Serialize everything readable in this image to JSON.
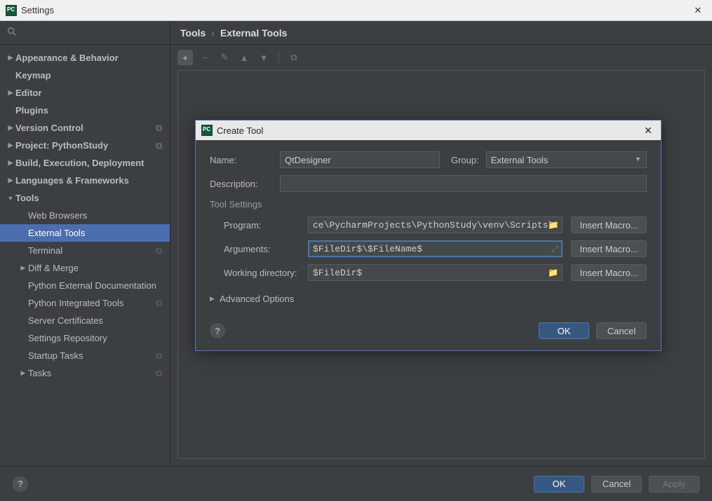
{
  "window": {
    "title": "Settings"
  },
  "search": {
    "placeholder": ""
  },
  "breadcrumb": {
    "root": "Tools",
    "leaf": "External Tools"
  },
  "sidebar": {
    "items": [
      {
        "label": "Appearance & Behavior",
        "bold": true,
        "arrow": "right"
      },
      {
        "label": "Keymap",
        "bold": true,
        "arrow": "none"
      },
      {
        "label": "Editor",
        "bold": true,
        "arrow": "right"
      },
      {
        "label": "Plugins",
        "bold": true,
        "arrow": "none"
      },
      {
        "label": "Version Control",
        "bold": true,
        "arrow": "right",
        "copy": true
      },
      {
        "label": "Project: PythonStudy",
        "bold": true,
        "arrow": "right",
        "copy": true
      },
      {
        "label": "Build, Execution, Deployment",
        "bold": true,
        "arrow": "right"
      },
      {
        "label": "Languages & Frameworks",
        "bold": true,
        "arrow": "right"
      },
      {
        "label": "Tools",
        "bold": true,
        "arrow": "down"
      },
      {
        "label": "Web Browsers",
        "indent": 1,
        "arrow": "none"
      },
      {
        "label": "External Tools",
        "indent": 1,
        "arrow": "none",
        "selected": true
      },
      {
        "label": "Terminal",
        "indent": 1,
        "arrow": "none",
        "copy": true
      },
      {
        "label": "Diff & Merge",
        "indent": 1,
        "arrow": "right"
      },
      {
        "label": "Python External Documentation",
        "indent": 1,
        "arrow": "none"
      },
      {
        "label": "Python Integrated Tools",
        "indent": 1,
        "arrow": "none",
        "copy": true
      },
      {
        "label": "Server Certificates",
        "indent": 1,
        "arrow": "none"
      },
      {
        "label": "Settings Repository",
        "indent": 1,
        "arrow": "none"
      },
      {
        "label": "Startup Tasks",
        "indent": 1,
        "arrow": "none",
        "copy": true
      },
      {
        "label": "Tasks",
        "indent": 1,
        "arrow": "right",
        "copy": true
      }
    ]
  },
  "toolbar_icons": [
    "+",
    "−",
    "✎",
    "▲",
    "▼",
    "⧉"
  ],
  "footer": {
    "ok": "OK",
    "cancel": "Cancel",
    "apply": "Apply"
  },
  "dialog": {
    "title": "Create Tool",
    "labels": {
      "name": "Name:",
      "group": "Group:",
      "description": "Description:",
      "tool_settings": "Tool Settings",
      "program": "Program:",
      "arguments": "Arguments:",
      "working_dir": "Working directory:",
      "advanced": "Advanced Options",
      "insert_macro": "Insert Macro...",
      "ok": "OK",
      "cancel": "Cancel"
    },
    "values": {
      "name": "QtDesigner",
      "group": "External Tools",
      "description": "",
      "program": "ce\\PycharmProjects\\PythonStudy\\venv\\Scripts\\designer.exe",
      "arguments": "$FileDir$\\$FileName$",
      "working_dir": "$FileDir$"
    }
  }
}
